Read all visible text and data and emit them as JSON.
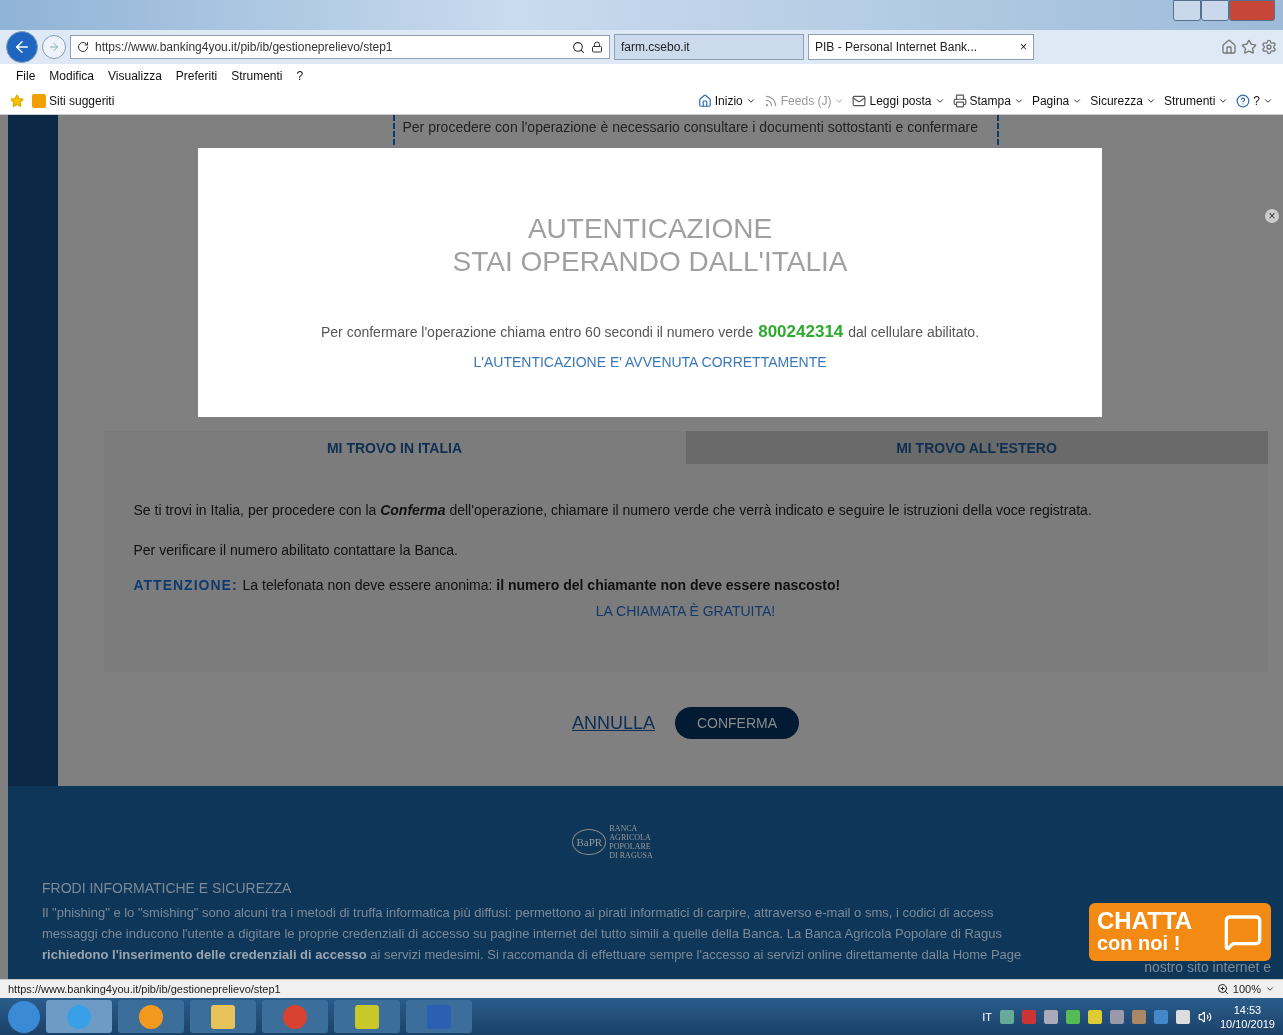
{
  "browser": {
    "address": "https://www.banking4you.it/pib/ib/gestioneprelievo/step1",
    "tabs": [
      {
        "label": "farm.csebo.it",
        "selected": false
      },
      {
        "label": "PIB - Personal Internet Bank...",
        "selected": true
      }
    ],
    "tab_close": "×",
    "menu": [
      "File",
      "Modifica",
      "Visualizza",
      "Preferiti",
      "Strumenti",
      "?"
    ],
    "favorites": "Siti suggeriti",
    "commands": [
      {
        "label": "Inizio",
        "kind": "home",
        "disabled": false
      },
      {
        "label": "Feeds (J)",
        "kind": "feeds",
        "disabled": true
      },
      {
        "label": "Leggi posta",
        "kind": "mail",
        "disabled": false
      },
      {
        "label": "Stampa",
        "kind": "print",
        "disabled": false
      },
      {
        "label": "Pagina",
        "kind": "menu",
        "disabled": false
      },
      {
        "label": "Sicurezza",
        "kind": "menu",
        "disabled": false
      },
      {
        "label": "Strumenti",
        "kind": "menu",
        "disabled": false
      },
      {
        "label": "?",
        "kind": "help",
        "disabled": false
      }
    ]
  },
  "page": {
    "notice": "Per procedere con l'operazione è necessario consultare i documenti sottostanti e confermare",
    "tabs": [
      {
        "label": "MI TROVO IN ITALIA",
        "selected": true
      },
      {
        "label": "MI TROVO ALL'ESTERO",
        "selected": false
      }
    ],
    "paragraphs": [
      "Se ti trovi in Italia, per procedere con la **Conferma** dell'operazione, chiamare il numero verde che verrà indicato e seguire le istruzioni della voce registrata.",
      "Per verificare il numero abilitato contattare la Banca."
    ],
    "warning_label": "ATTENZIONE:",
    "warning": "La telefonata non deve essere anonima: **il numero del chiamante non deve essere nascosto!**",
    "free_call": "LA CHIAMATA È GRATUITA!",
    "cancel": "ANNULLA",
    "confirm": "CONFERMA"
  },
  "modal": {
    "title_lines": [
      "AUTENTICAZIONE",
      "STAI OPERANDO DALL'ITALIA"
    ],
    "message_before": "Per confermare l'operazione chiama entro 60 secondi il numero verde",
    "phone_number": "800242314",
    "message_after": "dal cellulare abilitato.",
    "status": "L'AUTENTICAZIONE E' AVVENUTA CORRETTAMENTE"
  },
  "footer": {
    "logo_mark": "BaPR",
    "logo_lines": [
      "BANCA",
      "AGRICOLA",
      "POPOLARE",
      "DI RAGUSA"
    ],
    "heading": "FRODI INFORMATICHE E SICUREZZA",
    "lines": [
      "Il \"phishing\" e lo \"smishing\" sono alcuni tra i metodi di truffa informatica più diffusi: permettono ai pirati informatici di carpire, attraverso e-mail o sms, i codici di access",
      "messaggi che inducono l'utente a digitare le proprie credenziali di accesso su pagine internet del tutto simili a quelle della Banca. La Banca Agricola Popolare di Ragus",
      "**richiedono l'inserimento delle credenziali di accesso** ai servizi medesimi. Si raccomanda di effettuare sempre l'accesso ai servizi online direttamente dalla Home Page"
    ],
    "line_tail": "nostro sito internet e"
  },
  "chat": {
    "line1": "CHATTA",
    "line2": "con noi !",
    "close": "×"
  },
  "status_bar": {
    "url": "https://www.banking4you.it/pib/ib/gestioneprelievo/step1",
    "zoom": "100%"
  },
  "taskbar": {
    "language": "IT",
    "time": "14:53",
    "date": "10/10/2019"
  }
}
